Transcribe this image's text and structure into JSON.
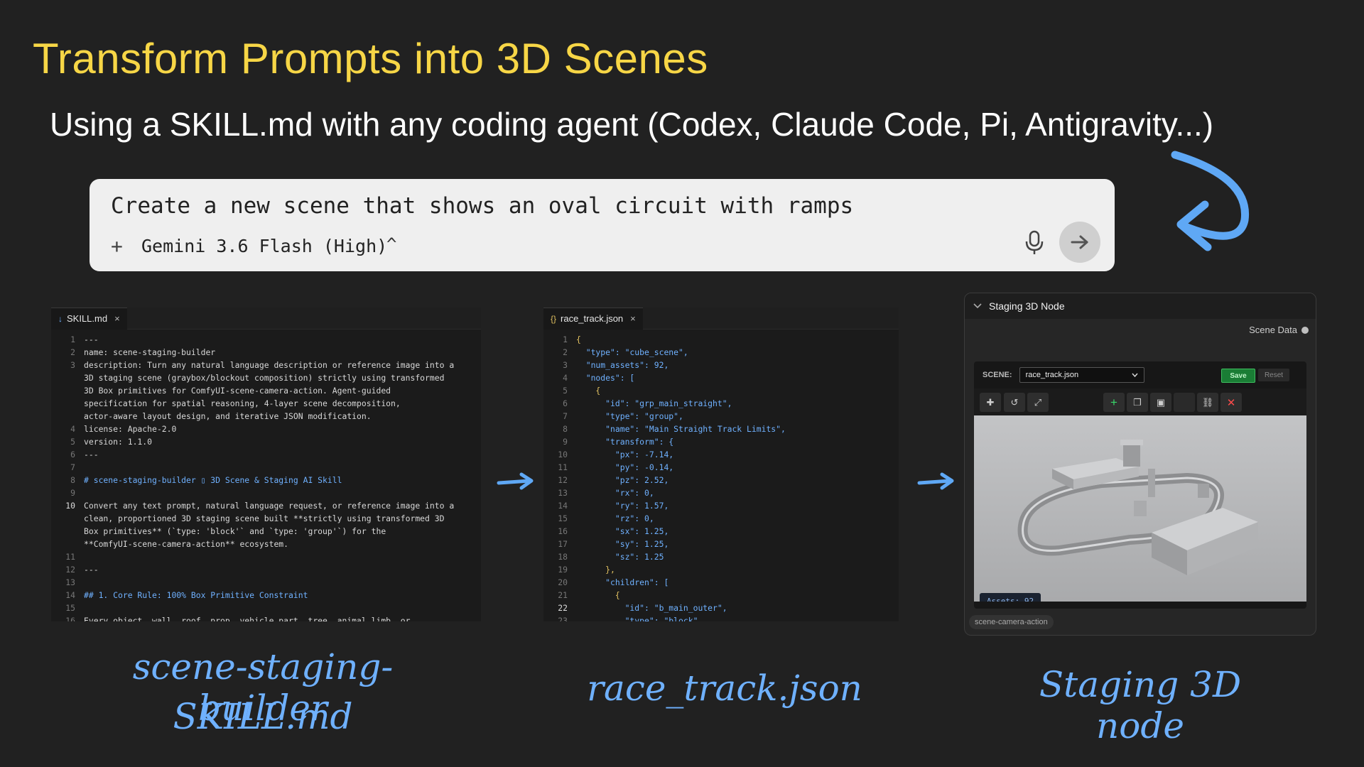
{
  "title": "Transform Prompts into 3D Scenes",
  "subtitle": "Using a SKILL.md with any coding agent (Codex, Claude Code, Pi, Antigravity...)",
  "prompt": {
    "text": "Create a new scene that shows an oval circuit with ramps",
    "plus": "+",
    "model": "Gemini 3.6 Flash (High)",
    "caret": "^"
  },
  "colors": {
    "title": "#f7d646",
    "accent": "#6fb1ff",
    "background": "#212121"
  },
  "skill_panel": {
    "tab_label": "SKILL.md",
    "tab_close": "×",
    "lines": [
      {
        "n": "1",
        "t": "---"
      },
      {
        "n": "2",
        "t": "name: scene-staging-builder"
      },
      {
        "n": "3",
        "t": "description: Turn any natural language description or reference image into a"
      },
      {
        "n": "",
        "t": "3D staging scene (graybox/blockout composition) strictly using transformed"
      },
      {
        "n": "",
        "t": "3D Box primitives for ComfyUI-scene-camera-action. Agent-guided"
      },
      {
        "n": "",
        "t": "specification for spatial reasoning, 4-layer scene decomposition,"
      },
      {
        "n": "",
        "t": "actor-aware layout design, and iterative JSON modification."
      },
      {
        "n": "4",
        "t": "license: Apache-2.0"
      },
      {
        "n": "5",
        "t": "version: 1.1.0"
      },
      {
        "n": "6",
        "t": "---"
      },
      {
        "n": "7",
        "t": ""
      },
      {
        "n": "8",
        "t": "# scene-staging-builder ▯ 3D Scene & Staging AI Skill"
      },
      {
        "n": "9",
        "t": ""
      },
      {
        "n": "10",
        "t": "Convert any text prompt, natural language request, or reference image into a"
      },
      {
        "n": "",
        "t": "clean, proportioned 3D staging scene built **strictly using transformed 3D"
      },
      {
        "n": "",
        "t": "Box primitives** (`type: 'block'` and `type: 'group'`) for the"
      },
      {
        "n": "",
        "t": "**ComfyUI-scene-camera-action** ecosystem."
      },
      {
        "n": "11",
        "t": ""
      },
      {
        "n": "12",
        "t": "---"
      },
      {
        "n": "13",
        "t": ""
      },
      {
        "n": "14",
        "t": "## 1. Core Rule: 100% Box Primitive Constraint"
      },
      {
        "n": "15",
        "t": ""
      },
      {
        "n": "16",
        "t": "Every object, wall, roof, prop, vehicle part, tree, animal limb, or"
      }
    ]
  },
  "json_panel": {
    "tab_icon": "{}",
    "tab_label": "race_track.json",
    "tab_close": "×",
    "lines": [
      {
        "n": "1",
        "t": "{"
      },
      {
        "n": "2",
        "t": "  \"type\": \"cube_scene\","
      },
      {
        "n": "3",
        "t": "  \"num_assets\": 92,"
      },
      {
        "n": "4",
        "t": "  \"nodes\": ["
      },
      {
        "n": "5",
        "t": "    {"
      },
      {
        "n": "6",
        "t": "      \"id\": \"grp_main_straight\","
      },
      {
        "n": "7",
        "t": "      \"type\": \"group\","
      },
      {
        "n": "8",
        "t": "      \"name\": \"Main Straight Track Limits\","
      },
      {
        "n": "9",
        "t": "      \"transform\": {"
      },
      {
        "n": "10",
        "t": "        \"px\": -7.14,"
      },
      {
        "n": "11",
        "t": "        \"py\": -0.14,"
      },
      {
        "n": "12",
        "t": "        \"pz\": 2.52,"
      },
      {
        "n": "13",
        "t": "        \"rx\": 0,"
      },
      {
        "n": "14",
        "t": "        \"ry\": 1.57,"
      },
      {
        "n": "15",
        "t": "        \"rz\": 0,"
      },
      {
        "n": "16",
        "t": "        \"sx\": 1.25,"
      },
      {
        "n": "17",
        "t": "        \"sy\": 1.25,"
      },
      {
        "n": "18",
        "t": "        \"sz\": 1.25"
      },
      {
        "n": "19",
        "t": "      },"
      },
      {
        "n": "20",
        "t": "      \"children\": ["
      },
      {
        "n": "21",
        "t": "        {"
      },
      {
        "n": "22",
        "t": "          \"id\": \"b_main_outer\","
      },
      {
        "n": "23",
        "t": "          \"type\": \"block\","
      }
    ]
  },
  "node_panel": {
    "title": "Staging 3D Node",
    "scene_data_label": "Scene Data",
    "scene_label": "SCENE:",
    "scene_value": "race_track.json",
    "save_label": "Save",
    "reset_label": "Reset",
    "assets_label": "Assets: 92",
    "footer_label": "scene-camera-action"
  },
  "captions": {
    "skill_line1": "scene-staging-builder",
    "skill_line2": "SKILL.md",
    "json": "race_track.json",
    "node": "Staging 3D node"
  }
}
